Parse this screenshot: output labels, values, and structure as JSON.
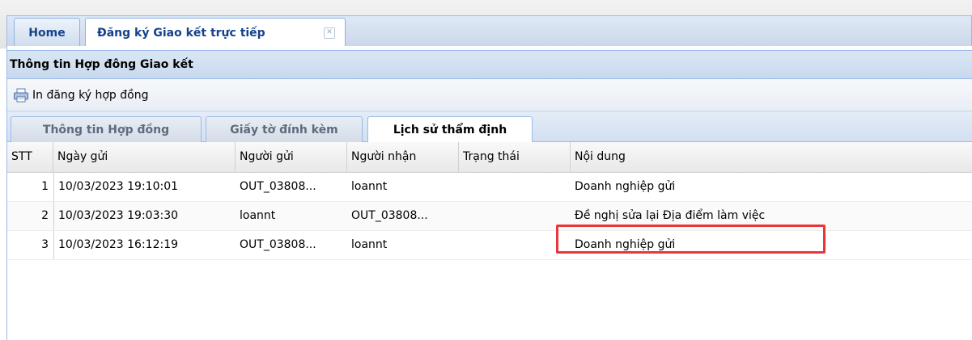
{
  "outer_tabs": {
    "home_label": "Home",
    "active_label": "Đăng ký Giao kết trực tiếp"
  },
  "panel": {
    "title": "Thông tin Hợp đông Giao kết"
  },
  "toolbar": {
    "print_label": "In đăng ký hợp đồng"
  },
  "inner_tabs": [
    {
      "label": "Thông tin Hợp đồng"
    },
    {
      "label": "Giấy tờ đính kèm"
    },
    {
      "label": "Lịch sử thẩm định"
    }
  ],
  "grid": {
    "columns": [
      "STT",
      "Ngày gửi",
      "Người gửi",
      "Người nhận",
      "Trạng thái",
      "Nội dung"
    ],
    "rows": [
      {
        "stt": "1",
        "ngay_gui": "10/03/2023 19:10:01",
        "nguoi_gui": "OUT_03808...",
        "nguoi_nhan": "loannt",
        "trang_thai": "",
        "noi_dung": "Doanh nghiệp gửi"
      },
      {
        "stt": "2",
        "ngay_gui": "10/03/2023 19:03:30",
        "nguoi_gui": "loannt",
        "nguoi_nhan": "OUT_03808...",
        "trang_thai": "",
        "noi_dung": "Đề nghị sửa lại Địa điểm làm việc"
      },
      {
        "stt": "3",
        "ngay_gui": "10/03/2023 16:12:19",
        "nguoi_gui": "OUT_03808...",
        "nguoi_nhan": "loannt",
        "trang_thai": "",
        "noi_dung": "Doanh nghiệp gửi"
      }
    ]
  },
  "colors": {
    "highlight": "#e8363a",
    "tab_text": "#15428b"
  }
}
